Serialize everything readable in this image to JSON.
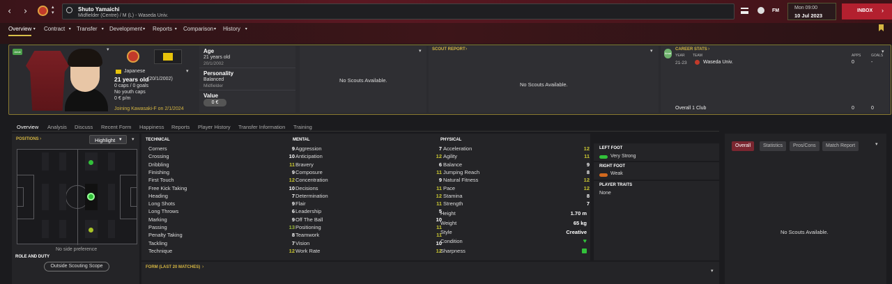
{
  "header": {
    "player_name": "Shuto Yamaichi",
    "player_sub": "Midfielder (Centre) / M (L) - Waseda Univ.",
    "day_time": "Mon 09:00",
    "date": "10 Jul 2023",
    "inbox_label": "INBOX",
    "fm_label": "FM"
  },
  "tabs": [
    "Overview",
    "Contract",
    "Transfer",
    "Development",
    "Reports",
    "Comparison",
    "History"
  ],
  "profile": {
    "badge": "Amat",
    "nationality": "Japanese",
    "age_line": "21 years old",
    "dob_paren": "(20/1/2002)",
    "caps": "0 caps / 0 goals",
    "youth_caps": "No youth caps",
    "wage": "0 € p/m",
    "joining": "Joining Kawasaki-F on 2/1/2024"
  },
  "info": {
    "age_label": "Age",
    "age_value": "21 years old",
    "age_dob": "20/1/2002",
    "personality_label": "Personality",
    "personality_value": "Balanced",
    "personality_role": "Midfielder",
    "value_label": "Value",
    "value_amount": "0 €"
  },
  "scouts": {
    "no_scouts_1": "No Scouts Available.",
    "report_title": "SCOUT REPORT",
    "no_scouts_2": "No Scouts Available.",
    "no_scouts_3": "No Scouts Available."
  },
  "career": {
    "title": "CAREER STATS",
    "badge": "Amat",
    "col_year": "YEAR",
    "col_team": "TEAM",
    "col_apps": "APPS",
    "col_goals": "GOALS",
    "row_year": "21-23",
    "row_team": "Waseda Univ.",
    "row_apps": "0",
    "row_goals": "-",
    "total_label": "Overall 1 Club",
    "total_apps": "0",
    "total_goals": "0"
  },
  "subtabs": [
    "Overview",
    "Analysis",
    "Discuss",
    "Recent Form",
    "Happiness",
    "Reports",
    "Player History",
    "Transfer Information",
    "Training"
  ],
  "positions": {
    "title": "POSITIONS",
    "dropdown": "Highlight",
    "side_pref": "No side preference",
    "role_title": "ROLE AND DUTY",
    "scope_button": "Outside Scouting Scope"
  },
  "technical": {
    "title": "TECHNICAL",
    "items": [
      {
        "name": "Corners",
        "value": "9"
      },
      {
        "name": "Crossing",
        "value": "10"
      },
      {
        "name": "Dribbling",
        "value": "11"
      },
      {
        "name": "Finishing",
        "value": "9"
      },
      {
        "name": "First Touch",
        "value": "12"
      },
      {
        "name": "Free Kick Taking",
        "value": "10"
      },
      {
        "name": "Heading",
        "value": "7"
      },
      {
        "name": "Long Shots",
        "value": "9"
      },
      {
        "name": "Long Throws",
        "value": "6"
      },
      {
        "name": "Marking",
        "value": "9"
      },
      {
        "name": "Passing",
        "value": "13"
      },
      {
        "name": "Penalty Taking",
        "value": "8"
      },
      {
        "name": "Tackling",
        "value": "7"
      },
      {
        "name": "Technique",
        "value": "12"
      }
    ]
  },
  "mental": {
    "title": "MENTAL",
    "items": [
      {
        "name": "Aggression",
        "value": "7"
      },
      {
        "name": "Anticipation",
        "value": "12"
      },
      {
        "name": "Bravery",
        "value": "6"
      },
      {
        "name": "Composure",
        "value": "11"
      },
      {
        "name": "Concentration",
        "value": "9"
      },
      {
        "name": "Decisions",
        "value": "11"
      },
      {
        "name": "Determination",
        "value": "12"
      },
      {
        "name": "Flair",
        "value": "11"
      },
      {
        "name": "Leadership",
        "value": "5"
      },
      {
        "name": "Off The Ball",
        "value": "10"
      },
      {
        "name": "Positioning",
        "value": "11"
      },
      {
        "name": "Teamwork",
        "value": "11"
      },
      {
        "name": "Vision",
        "value": "10"
      },
      {
        "name": "Work Rate",
        "value": "12"
      }
    ]
  },
  "physical": {
    "title": "PHYSICAL",
    "items": [
      {
        "name": "Acceleration",
        "value": "12"
      },
      {
        "name": "Agility",
        "value": "11"
      },
      {
        "name": "Balance",
        "value": "9"
      },
      {
        "name": "Jumping Reach",
        "value": "8"
      },
      {
        "name": "Natural Fitness",
        "value": "12"
      },
      {
        "name": "Pace",
        "value": "12"
      },
      {
        "name": "Stamina",
        "value": "8"
      },
      {
        "name": "Strength",
        "value": "7"
      }
    ],
    "height_label": "Height",
    "height_value": "1.70 m",
    "weight_label": "Weight",
    "weight_value": "65 kg",
    "style_label": "Style",
    "style_value": "Creative",
    "condition_label": "Condition",
    "sharpness_label": "Sharpness"
  },
  "feet": {
    "left_title": "LEFT FOOT",
    "left_value": "Very Strong",
    "right_title": "RIGHT FOOT",
    "right_value": "Weak",
    "traits_title": "PLAYER TRAITS",
    "traits_value": "None"
  },
  "form_title": "FORM (LAST 20 MATCHES)",
  "right_tabs": [
    "Overall",
    "Statistics",
    "Pros/Cons",
    "Match Report"
  ],
  "colors": {
    "accent": "#d5b642",
    "inbox": "#b3202f",
    "green": "#32c13a"
  }
}
